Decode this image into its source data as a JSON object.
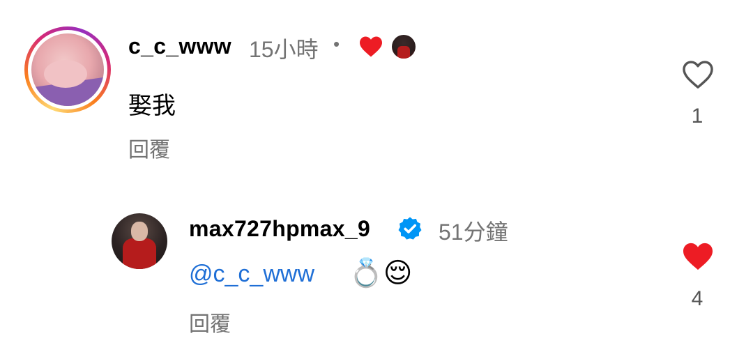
{
  "comment": {
    "username": "c_c_www",
    "time": "15小時",
    "dot": "•",
    "text": "娶我",
    "reply_label": "回覆",
    "like_count": "1"
  },
  "reply": {
    "username": "max727hpmax_9",
    "time": "51分鐘",
    "mention": "@c_c_www",
    "emojis": "💍😌",
    "reply_label": "回覆",
    "like_count": "4"
  },
  "colors": {
    "liked": "#ed1c24",
    "verified": "#0095f6",
    "mention": "#1f6fd6",
    "meta": "#737373"
  }
}
